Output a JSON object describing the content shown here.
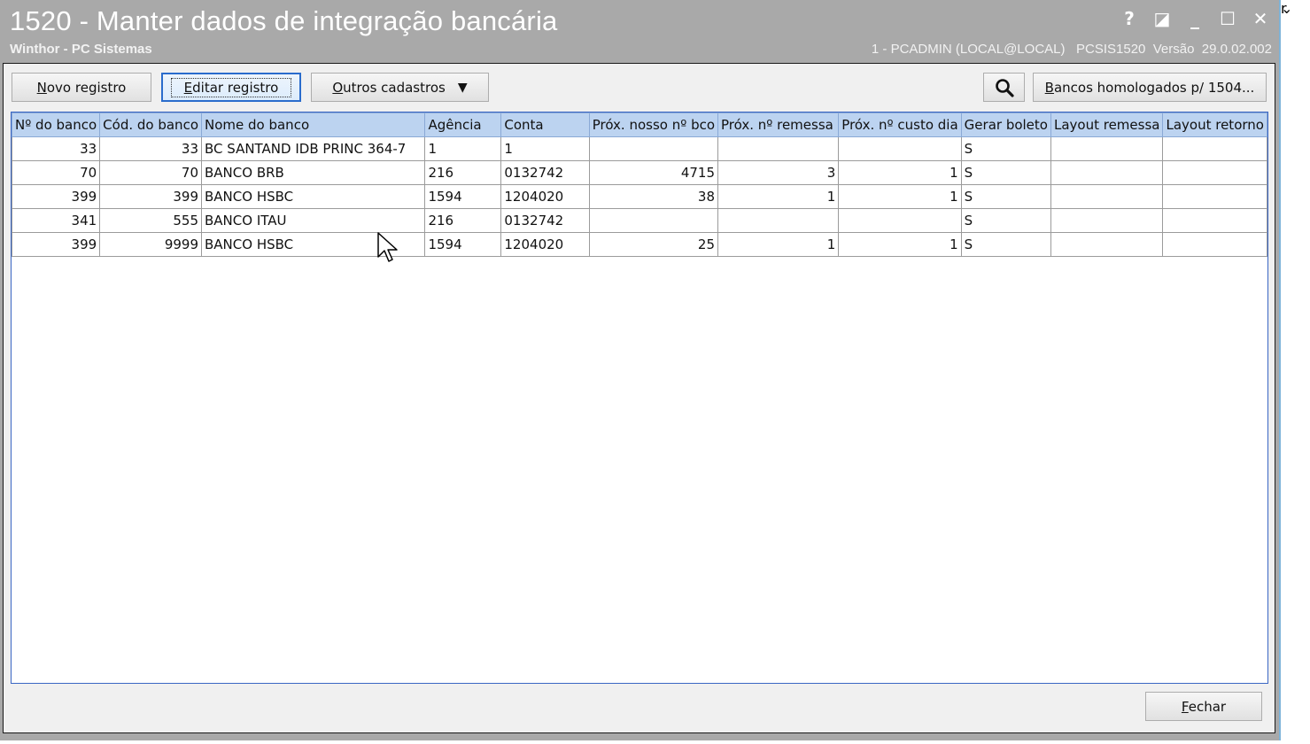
{
  "window": {
    "title": "1520 - Manter dados de integração bancária",
    "subtitle": "Winthor - PC Sistemas",
    "session_info": "1 - PCADMIN (LOCAL@LOCAL)   PCSIS1520  Versão  29.0.02.002",
    "controls": {
      "help": "?",
      "restore": "◪",
      "minimize": "_",
      "maximize": "☐",
      "close": "✕"
    }
  },
  "background": {
    "edge_text": "r",
    "chevron": "⌄"
  },
  "toolbar": {
    "new_record": {
      "prefix": "",
      "mnemonic": "N",
      "rest": "ovo registro"
    },
    "edit_record": {
      "prefix": "",
      "mnemonic": "E",
      "rest": "ditar registro"
    },
    "other_records": {
      "prefix": "",
      "mnemonic": "O",
      "rest": "utros cadastros",
      "arrow": "▼"
    },
    "approved_banks": {
      "prefix": "",
      "mnemonic": "B",
      "rest": "ancos homologados p/ 1504..."
    }
  },
  "grid": {
    "columns": [
      "Nº do banco",
      "Cód. do banco",
      "Nome do banco",
      "Agência",
      "Conta",
      "Próx. nosso nº bco",
      "Próx. nº remessa",
      "Próx. nº custo dia",
      "Gerar boleto",
      "Layout remessa",
      "Layout retorno"
    ],
    "rows": [
      [
        "33",
        "33",
        "BC SANTAND IDB PRINC 364-7",
        "1",
        "1",
        "",
        "",
        "",
        "S",
        "",
        ""
      ],
      [
        "70",
        "70",
        "BANCO BRB",
        "216",
        "0132742",
        "4715",
        "3",
        "1",
        "S",
        "",
        ""
      ],
      [
        "399",
        "399",
        "BANCO HSBC",
        "1594",
        "1204020",
        "38",
        "1",
        "1",
        "S",
        "",
        ""
      ],
      [
        "341",
        "555",
        "BANCO ITAU",
        "216",
        "0132742",
        "",
        "",
        "",
        "S",
        "",
        ""
      ],
      [
        "399",
        "9999",
        "BANCO HSBC",
        "1594",
        "1204020",
        "25",
        "1",
        "1",
        "S",
        "",
        ""
      ]
    ]
  },
  "footer": {
    "close": {
      "prefix": "",
      "mnemonic": "F",
      "rest": "echar"
    }
  },
  "colors": {
    "titlebar": "#a9a9a9",
    "header": "#bcd3f0",
    "focus": "#2a6ccc"
  }
}
